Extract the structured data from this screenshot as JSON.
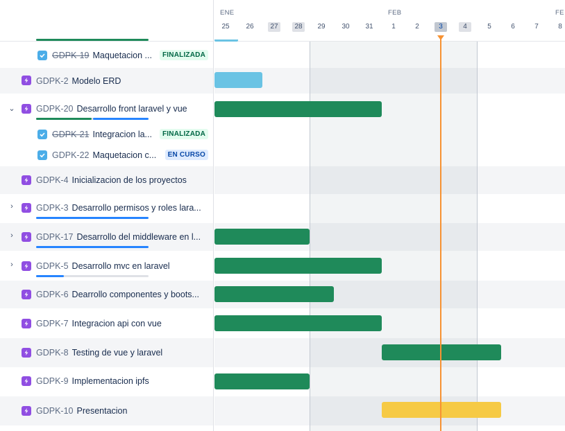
{
  "colors": {
    "bar_green": "#1f8a5a",
    "bar_blue": "#6ac3e4",
    "bar_yellow": "#f6ca45",
    "today_line": "#f79232",
    "progress_green": "#1f8a5a",
    "progress_blue": "#2684ff"
  },
  "timeline": {
    "months": [
      "ENE",
      "FEB",
      "FE"
    ],
    "days": [
      "25",
      "26",
      "27",
      "28",
      "29",
      "30",
      "31",
      "1",
      "2",
      "3",
      "4",
      "5",
      "6",
      "7",
      "8"
    ]
  },
  "rows": [
    {
      "key": "GDPK-19",
      "summary": "Maquetacion ...",
      "badge": "FINALIZADA",
      "done": true
    },
    {
      "key": "GDPK-2",
      "summary": "Modelo ERD"
    },
    {
      "key": "GDPK-20",
      "summary": "Desarrollo front laravel y vue"
    },
    {
      "key": "GDPK-21",
      "summary": "Integracion la...",
      "badge": "FINALIZADA",
      "done": true
    },
    {
      "key": "GDPK-22",
      "summary": "Maquetacion c...",
      "badge": "EN CURSO"
    },
    {
      "key": "GDPK-4",
      "summary": "Inicializacion de los proyectos"
    },
    {
      "key": "GDPK-3",
      "summary": "Desarrollo permisos y roles lara..."
    },
    {
      "key": "GDPK-17",
      "summary": "Desarrollo del middleware en l..."
    },
    {
      "key": "GDPK-5",
      "summary": "Desarrollo mvc en laravel"
    },
    {
      "key": "GDPK-6",
      "summary": "Dearrollo componentes y boots..."
    },
    {
      "key": "GDPK-7",
      "summary": "Integracion api con vue"
    },
    {
      "key": "GDPK-8",
      "summary": "Testing de vue y laravel"
    },
    {
      "key": "GDPK-9",
      "summary": "Implementacion ipfs"
    },
    {
      "key": "GDPK-10",
      "summary": "Presentacion"
    }
  ]
}
